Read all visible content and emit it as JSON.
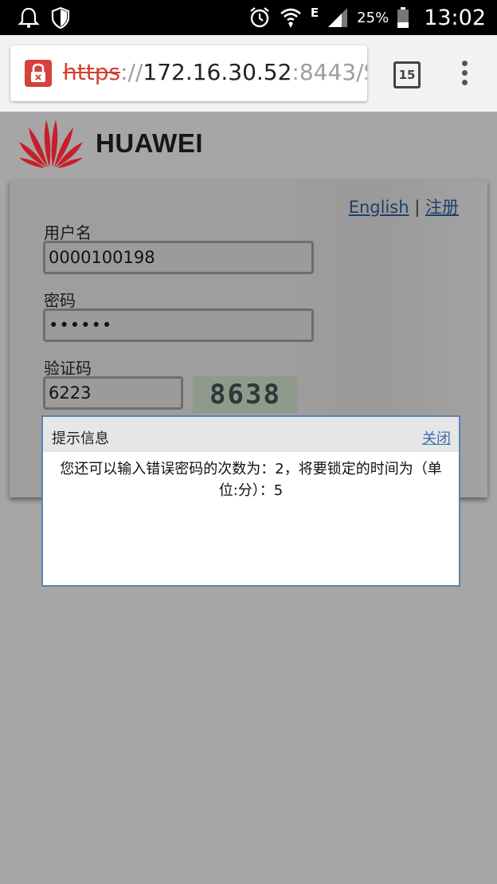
{
  "status_bar": {
    "left_icons": [
      "notification-bell-icon",
      "shield-icon"
    ],
    "network_label": "E",
    "battery_percent": "25%",
    "time": "13:02"
  },
  "browser": {
    "url_scheme": "https",
    "url_separator": "://",
    "url_host": "172.16.30.52",
    "url_rest": ":8443/S",
    "tab_count": "15"
  },
  "brand": {
    "name": "HUAWEI"
  },
  "login": {
    "lang_link": "English",
    "link_separator": "|",
    "register_link": "注册",
    "username_label": "用户名",
    "username_value": "0000100198",
    "password_label": "密码",
    "password_value": "••••••",
    "captcha_label": "验证码",
    "captcha_value": "6223",
    "captcha_image_text": "8638"
  },
  "dialog": {
    "title": "提示信息",
    "close_label": "关闭",
    "message": "您还可以输入错误密码的次数为：2，将要锁定的时间为（单位:分）：5"
  }
}
